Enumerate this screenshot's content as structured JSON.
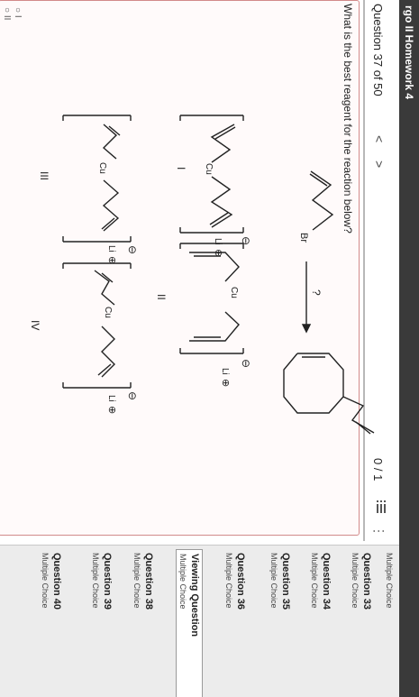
{
  "app": {
    "title": "rgo II Homework 4"
  },
  "question": {
    "counter": "Question 37 of 50",
    "prev_icon": "<",
    "next_icon": ">",
    "score": "0 / 1",
    "prompt": "What is the best reagent for the reaction below?",
    "reaction": {
      "substituent": "Br",
      "arrow_label": "?",
      "option_labels": [
        "I",
        "II",
        "III",
        "IV"
      ],
      "metal": "Cu",
      "counter_ion": "Li",
      "minus_sign": "⊖",
      "plus_sign": "⊕"
    }
  },
  "answers": [
    "I",
    "II"
  ],
  "sidebar": {
    "top_partial": "Multiple Choice",
    "items": [
      {
        "title": "Question 33",
        "sub": "Multiple Choice",
        "active": false
      },
      {
        "title": "Question 34",
        "sub": "Multiple Choice",
        "active": false
      },
      {
        "title": "Question 35",
        "sub": "Multiple Choice",
        "active": false
      },
      {
        "title": "Question 36",
        "sub": "Multiple Choice",
        "active": false
      },
      {
        "title": "Viewing Question",
        "sub": "Multiple Choice",
        "active": true
      },
      {
        "title": "Question 38",
        "sub": "Multiple Choice",
        "active": false
      },
      {
        "title": "Question 39",
        "sub": "Multiple Choice",
        "active": false
      },
      {
        "title": "Question 40",
        "sub": "Multiple Choice",
        "active": false
      }
    ]
  },
  "icons": {
    "list": "list-icon",
    "more": "more-options-icon",
    "prev": "chevron-left-icon",
    "next": "chevron-right-icon"
  }
}
